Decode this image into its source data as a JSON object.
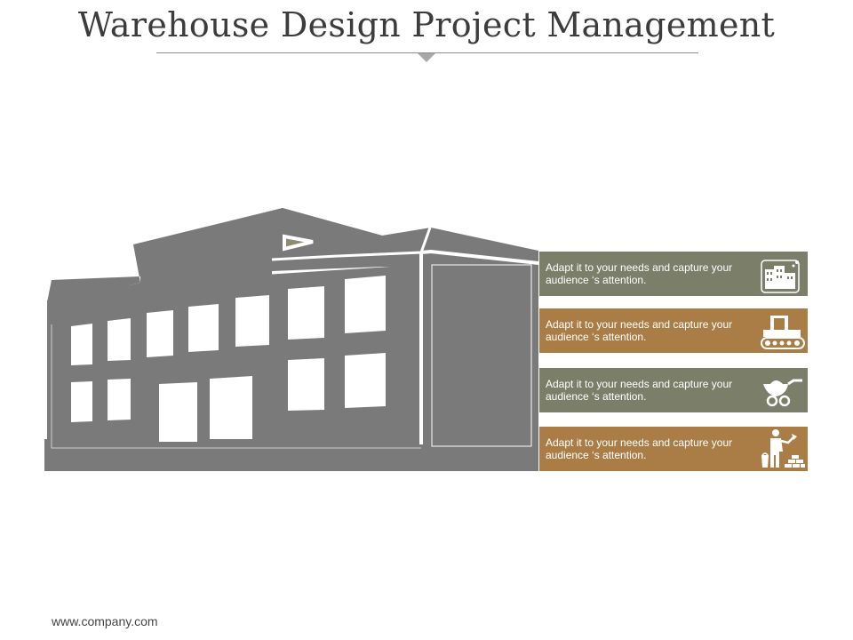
{
  "title": "Warehouse Design Project Management",
  "footer": "www.company.com",
  "colors": {
    "building": "#7a7a7a",
    "band_green": "#7b7f6a",
    "band_brown": "#a97d45",
    "text": "#3c3c3c"
  },
  "bands": [
    {
      "text": "Adapt it to your needs and capture your audience ‘s attention.",
      "icon": "buildings-icon",
      "color": "green"
    },
    {
      "text": "Adapt it to your needs and capture your audience ‘s attention.",
      "icon": "bulldozer-icon",
      "color": "brown"
    },
    {
      "text": "Adapt it to your needs and capture your audience ‘s attention.",
      "icon": "wheelbarrow-icon",
      "color": "green"
    },
    {
      "text": "Adapt it to your needs and capture your audience ‘s attention.",
      "icon": "bricklayer-icon",
      "color": "brown"
    }
  ]
}
